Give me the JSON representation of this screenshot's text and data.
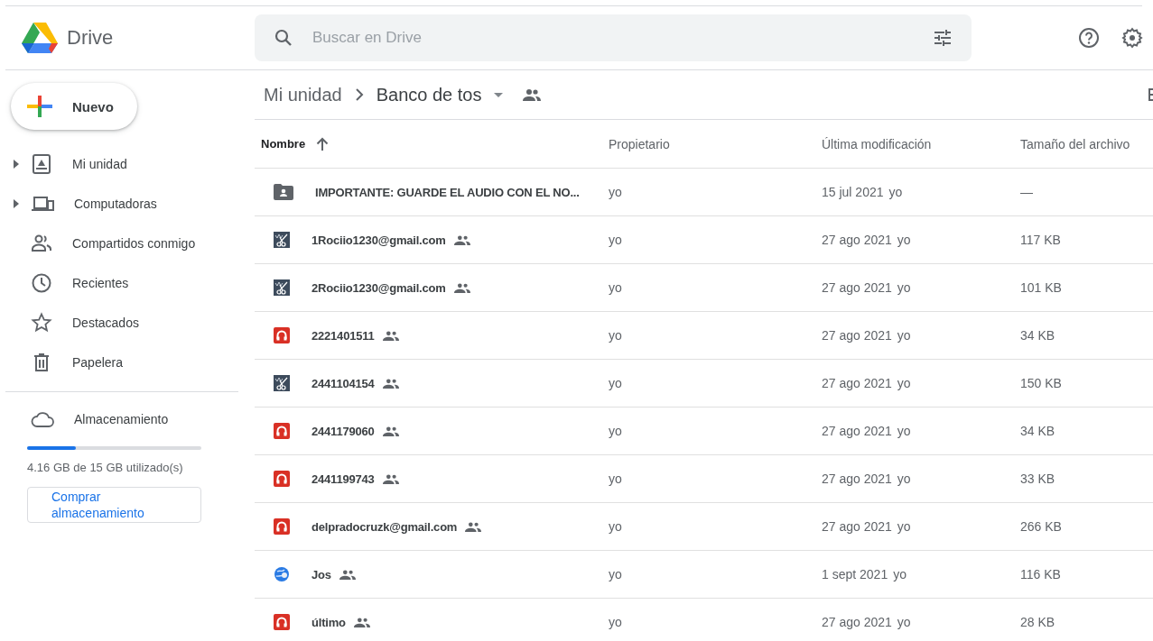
{
  "app": {
    "name": "Drive"
  },
  "search": {
    "placeholder": "Buscar en Drive"
  },
  "new_button": {
    "label": "Nuevo"
  },
  "sidebar": {
    "items": [
      {
        "label": "Mi unidad",
        "kind": "drive",
        "expandable": true,
        "selected": false
      },
      {
        "label": "Computadoras",
        "kind": "computers",
        "expandable": true,
        "selected": false
      },
      {
        "label": "Compartidos conmigo",
        "kind": "shared",
        "expandable": false,
        "selected": false
      },
      {
        "label": "Recientes",
        "kind": "recent",
        "expandable": false,
        "selected": false
      },
      {
        "label": "Destacados",
        "kind": "starred",
        "expandable": false,
        "selected": false
      },
      {
        "label": "Papelera",
        "kind": "trash",
        "expandable": false,
        "selected": false
      }
    ]
  },
  "storage": {
    "label": "Almacenamiento",
    "level": 0.28,
    "usage": "4.16 GB de 15 GB utilizado(s)",
    "buy_button": "Comprar almacenamiento"
  },
  "breadcrumb": [
    {
      "label": "Mi unidad",
      "current": false
    },
    {
      "label": "Banco de tos",
      "current": true
    }
  ],
  "table": {
    "columns": [
      {
        "label": "Nombre",
        "sorted": true
      },
      {
        "label": "Propietario",
        "sorted": false
      },
      {
        "label": "Última modificación",
        "sorted": false
      },
      {
        "label": "Tamaño del archivo",
        "sorted": false
      }
    ],
    "rows": [
      {
        "kind": "folder",
        "name": "IMPORTANTE: GUARDE EL AUDIO CON EL NO...",
        "shared": false,
        "owner": "yo",
        "modified": "15 jul 2021",
        "modified_by": "yo",
        "size": "—"
      },
      {
        "kind": "audio-edit",
        "name": "1Rociio1230@gmail.com",
        "shared": true,
        "owner": "yo",
        "modified": "27 ago 2021",
        "modified_by": "yo",
        "size": "117 KB"
      },
      {
        "kind": "audio-edit",
        "name": "2Rociio1230@gmail.com",
        "shared": true,
        "owner": "yo",
        "modified": "27 ago 2021",
        "modified_by": "yo",
        "size": "101 KB"
      },
      {
        "kind": "audio",
        "name": "2221401511",
        "shared": true,
        "owner": "yo",
        "modified": "27 ago 2021",
        "modified_by": "yo",
        "size": "34 KB"
      },
      {
        "kind": "audio-edit",
        "name": "2441104154",
        "shared": true,
        "owner": "yo",
        "modified": "27 ago 2021",
        "modified_by": "yo",
        "size": "150 KB"
      },
      {
        "kind": "audio",
        "name": "2441179060",
        "shared": true,
        "owner": "yo",
        "modified": "27 ago 2021",
        "modified_by": "yo",
        "size": "34 KB"
      },
      {
        "kind": "audio",
        "name": "2441199743",
        "shared": true,
        "owner": "yo",
        "modified": "27 ago 2021",
        "modified_by": "yo",
        "size": "33 KB"
      },
      {
        "kind": "audio",
        "name": "delpradocruzk@gmail.com",
        "shared": true,
        "owner": "yo",
        "modified": "27 ago 2021",
        "modified_by": "yo",
        "size": "266 KB"
      },
      {
        "kind": "globe",
        "name": "Jos",
        "shared": true,
        "owner": "yo",
        "modified": "1 sept 2021",
        "modified_by": "yo",
        "size": "116 KB"
      },
      {
        "kind": "audio",
        "name": "último",
        "shared": true,
        "owner": "yo",
        "modified": "27 ago 2021",
        "modified_by": "yo",
        "size": "28 KB"
      }
    ]
  }
}
